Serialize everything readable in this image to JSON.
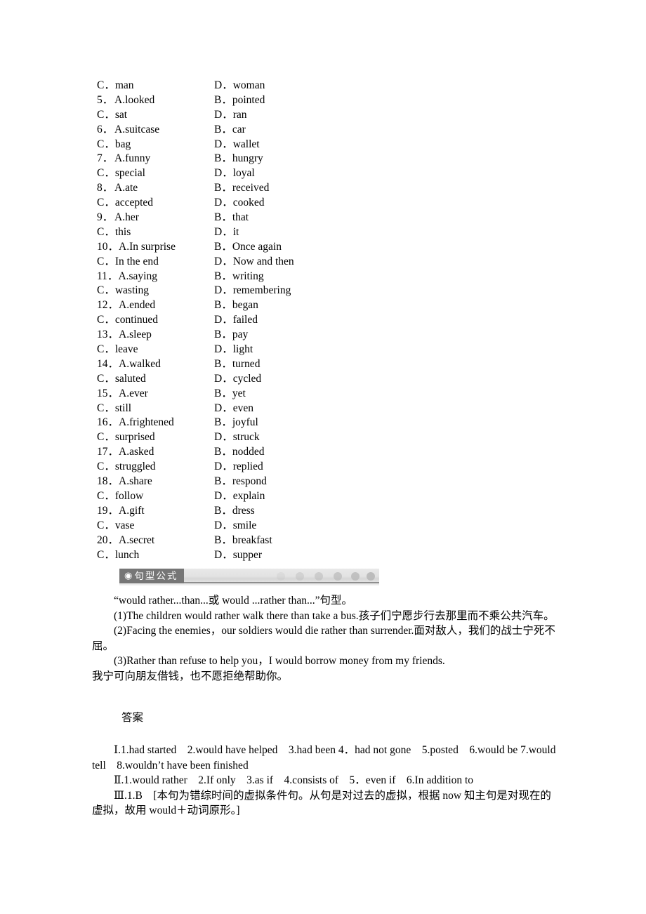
{
  "options_list": [
    {
      "left_lead": "C．",
      "left_text": "man",
      "right_lead": "D．",
      "right_text": "woman"
    },
    {
      "left_lead": "5．",
      "left_text": "A.looked",
      "right_lead": "B．",
      "right_text": "pointed"
    },
    {
      "left_lead": "C．",
      "left_text": "sat",
      "right_lead": "D．",
      "right_text": "ran"
    },
    {
      "left_lead": "6．",
      "left_text": "A.suitcase",
      "right_lead": "B．",
      "right_text": "car"
    },
    {
      "left_lead": "C．",
      "left_text": "bag",
      "right_lead": "D．",
      "right_text": "wallet"
    },
    {
      "left_lead": "7．",
      "left_text": "A.funny",
      "right_lead": "B．",
      "right_text": "hungry"
    },
    {
      "left_lead": "C．",
      "left_text": "special",
      "right_lead": "D．",
      "right_text": "loyal"
    },
    {
      "left_lead": "8．",
      "left_text": "A.ate",
      "right_lead": "B．",
      "right_text": "received"
    },
    {
      "left_lead": "C．",
      "left_text": "accepted",
      "right_lead": "D．",
      "right_text": "cooked"
    },
    {
      "left_lead": "9．",
      "left_text": "A.her",
      "right_lead": "B．",
      "right_text": "that"
    },
    {
      "left_lead": "C．",
      "left_text": "this",
      "right_lead": "D．",
      "right_text": "it"
    },
    {
      "left_lead": "10．",
      "left_text": "A.In surprise",
      "right_lead": "B．",
      "right_text": "Once again"
    },
    {
      "left_lead": "C．",
      "left_text": "In the end",
      "right_lead": "D．",
      "right_text": "Now and then"
    },
    {
      "left_lead": "11．",
      "left_text": "A.saying",
      "right_lead": "B．",
      "right_text": "writing"
    },
    {
      "left_lead": "C．",
      "left_text": "wasting",
      "right_lead": "D．",
      "right_text": "remembering"
    },
    {
      "left_lead": "12．",
      "left_text": "A.ended",
      "right_lead": "B．",
      "right_text": "began"
    },
    {
      "left_lead": "C．",
      "left_text": "continued",
      "right_lead": "D．",
      "right_text": "failed"
    },
    {
      "left_lead": "13．",
      "left_text": "A.sleep",
      "right_lead": "B．",
      "right_text": "pay"
    },
    {
      "left_lead": "C．",
      "left_text": "leave",
      "right_lead": "D．",
      "right_text": "light"
    },
    {
      "left_lead": "14．",
      "left_text": "A.walked",
      "right_lead": "B．",
      "right_text": "turned"
    },
    {
      "left_lead": "C．",
      "left_text": "saluted",
      "right_lead": "D．",
      "right_text": "cycled"
    },
    {
      "left_lead": "15．",
      "left_text": "A.ever",
      "right_lead": "B．",
      "right_text": "yet"
    },
    {
      "left_lead": "C．",
      "left_text": "still",
      "right_lead": "D．",
      "right_text": "even"
    },
    {
      "left_lead": "16．",
      "left_text": "A.frightened",
      "right_lead": "B．",
      "right_text": "joyful"
    },
    {
      "left_lead": "C．",
      "left_text": "surprised",
      "right_lead": "D．",
      "right_text": "struck"
    },
    {
      "left_lead": "17．",
      "left_text": "A.asked",
      "right_lead": "B．",
      "right_text": "nodded"
    },
    {
      "left_lead": "C．",
      "left_text": "struggled",
      "right_lead": "D．",
      "right_text": "replied"
    },
    {
      "left_lead": "18．",
      "left_text": "A.share",
      "right_lead": "B．",
      "right_text": "respond"
    },
    {
      "left_lead": "C．",
      "left_text": "follow",
      "right_lead": "D．",
      "right_text": "explain"
    },
    {
      "left_lead": "19．",
      "left_text": "A.gift",
      "right_lead": "B．",
      "right_text": "dress"
    },
    {
      "left_lead": "C．",
      "left_text": "vase",
      "right_lead": "D．",
      "right_text": "smile"
    },
    {
      "left_lead": "20．",
      "left_text": "A.secret",
      "right_lead": "B．",
      "right_text": "breakfast"
    },
    {
      "left_lead": "C．",
      "left_text": "lunch",
      "right_lead": "D．",
      "right_text": "supper"
    }
  ],
  "section": {
    "bullet_glyph": "◉",
    "title": "句型公式"
  },
  "grammar": {
    "headline": "“would rather...than...或 would ...rather than...”句型。",
    "example1": "(1)The children would rather walk there than take a bus.孩子们宁愿步行去那里而不乘公共汽车。",
    "example2": "(2)Facing the enemies，our soldiers would die rather than surrender.面对敌人，我们的战士宁死不屈。",
    "example3": "(3)Rather than refuse to help you，I would borrow money from my friends.",
    "example3_translation": "我宁可向朋友借钱，也不愿拒绝帮助你。"
  },
  "answers": {
    "title": "答案",
    "section1": "Ⅰ.1.had started　2.would have helped　3.had been 4．had not gone　5.posted　6.would be 7.would tell　8.wouldn’t have been finished",
    "section2": "Ⅱ.1.would rather　2.If only　3.as if　4.consists of　5．even if　6.In addition to",
    "section3": "Ⅲ.1.B　[本句为错综时间的虚拟条件句。从句是对过去的虚拟，根据 now 知主句是对现在的虚拟，故用 would＋动词原形。]"
  }
}
